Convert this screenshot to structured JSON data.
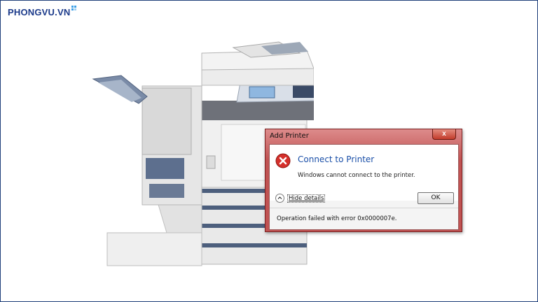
{
  "logo": {
    "text": "PHONGVU.VN",
    "accent_color": "#3da0e6",
    "brand_color": "#1b3a8a"
  },
  "dialog": {
    "title": "Add Printer",
    "close_symbol": "x",
    "heading": "Connect to Printer",
    "message": "Windows cannot connect to the printer.",
    "hide_details_label": "Hide details",
    "ok_label": "OK",
    "error_detail": "Operation failed with error 0x0000007e.",
    "icon": "error-icon",
    "frame_color": "#c05252"
  }
}
